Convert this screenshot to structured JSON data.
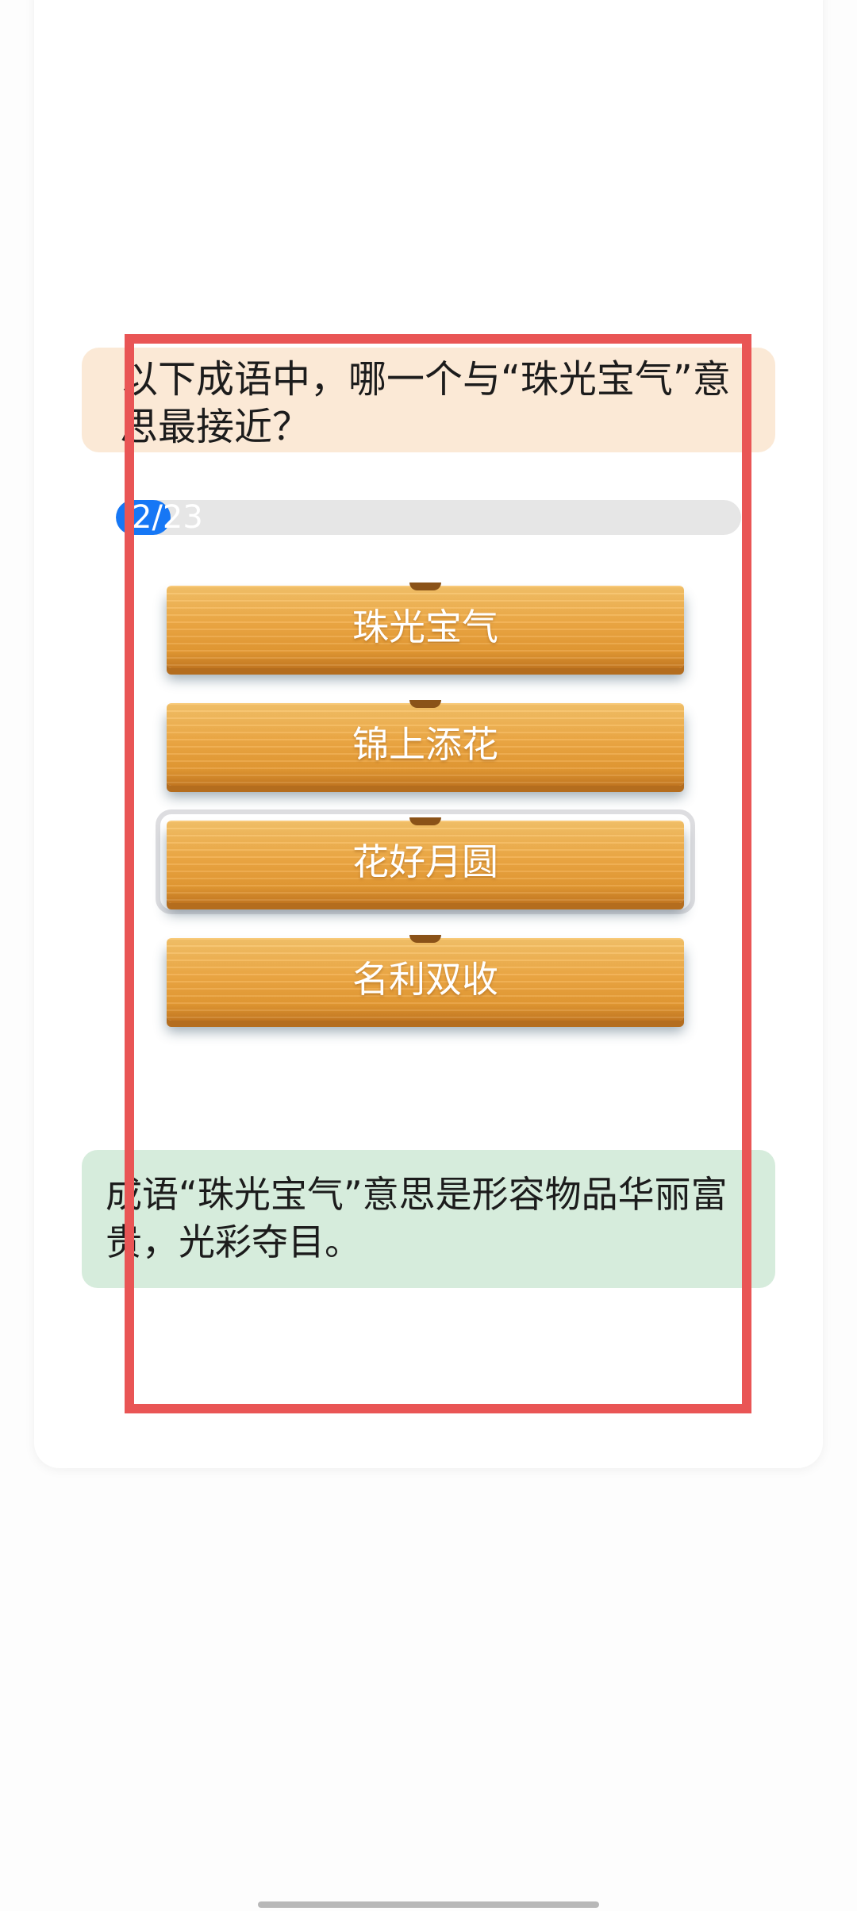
{
  "question": {
    "text": "以下成语中，哪一个与“珠光宝气”意思最接近？"
  },
  "progress": {
    "label": "2/23",
    "current": 2,
    "total": 23,
    "fill_fraction": 0.087
  },
  "options": [
    {
      "label": "珠光宝气",
      "selected": false
    },
    {
      "label": "锦上添花",
      "selected": false
    },
    {
      "label": "花好月圆",
      "selected": true
    },
    {
      "label": "名利双收",
      "selected": false
    }
  ],
  "explanation": {
    "text": "成语“珠光宝气”意思是形容物品华丽富贵，光彩夺目。"
  },
  "colors": {
    "question_bg": "#fbe9d6",
    "explanation_bg": "#d6ecdc",
    "progress_fill": "#1677f5",
    "highlight": "#e95555"
  }
}
